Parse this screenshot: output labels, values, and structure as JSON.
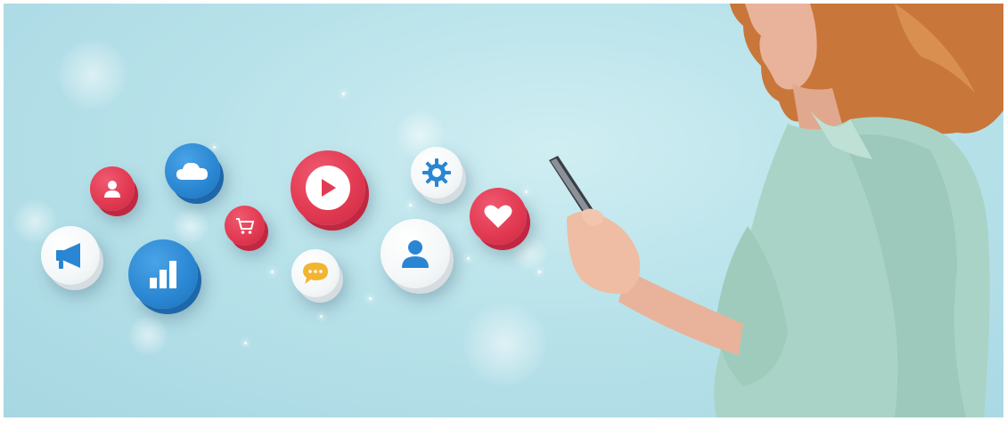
{
  "scene": {
    "background_color": "#b8e2ea",
    "accent_red": "#e23a52",
    "accent_blue": "#2a86d2",
    "accent_yellow": "#f2b531",
    "shirt_color": "#a9d3c6",
    "hair_color": "#c9763a"
  },
  "icons": [
    {
      "name": "megaphone-icon",
      "style": "white"
    },
    {
      "name": "user-icon",
      "style": "red"
    },
    {
      "name": "cloud-icon",
      "style": "blue"
    },
    {
      "name": "bar-chart-icon",
      "style": "blue"
    },
    {
      "name": "shopping-cart-icon",
      "style": "red"
    },
    {
      "name": "play-icon",
      "style": "red"
    },
    {
      "name": "chat-bubble-icon",
      "style": "white"
    },
    {
      "name": "gear-icon",
      "style": "white"
    },
    {
      "name": "user-profile-icon",
      "style": "white"
    },
    {
      "name": "heart-icon",
      "style": "red"
    }
  ]
}
